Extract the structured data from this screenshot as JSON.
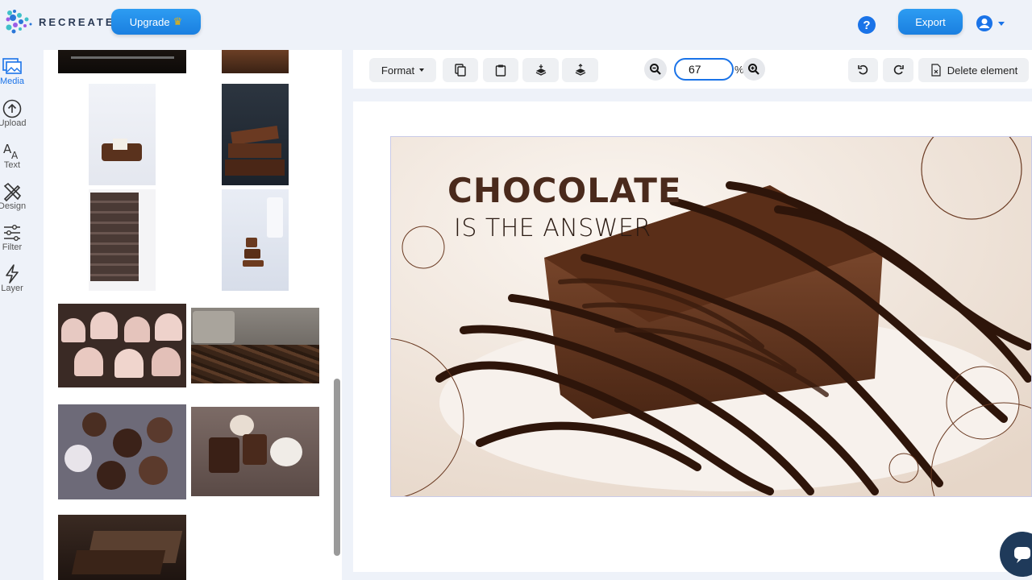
{
  "app": {
    "brand": "RECREATE",
    "upgrade_label": "Upgrade",
    "export_label": "Export",
    "help_glyph": "?"
  },
  "rail": {
    "items": [
      {
        "label": "Media",
        "icon": "image-icon",
        "active": true
      },
      {
        "label": "Upload",
        "icon": "upload-icon",
        "active": false
      },
      {
        "label": "Text",
        "icon": "text-icon",
        "active": false
      },
      {
        "label": "Design",
        "icon": "design-icon",
        "active": false
      },
      {
        "label": "Filter",
        "icon": "sliders-icon",
        "active": false
      },
      {
        "label": "Layer",
        "icon": "layer-icon",
        "active": false
      }
    ]
  },
  "toolbar": {
    "format_label": "Format",
    "zoom_value": "67",
    "zoom_unit": "%",
    "delete_label": "Delete element"
  },
  "design": {
    "title": "CHOCOLATE",
    "subtitle": "IS THE ANSWER"
  },
  "colors": {
    "accent": "#1a73e8",
    "chocolate_dark": "#4a2a1c"
  }
}
